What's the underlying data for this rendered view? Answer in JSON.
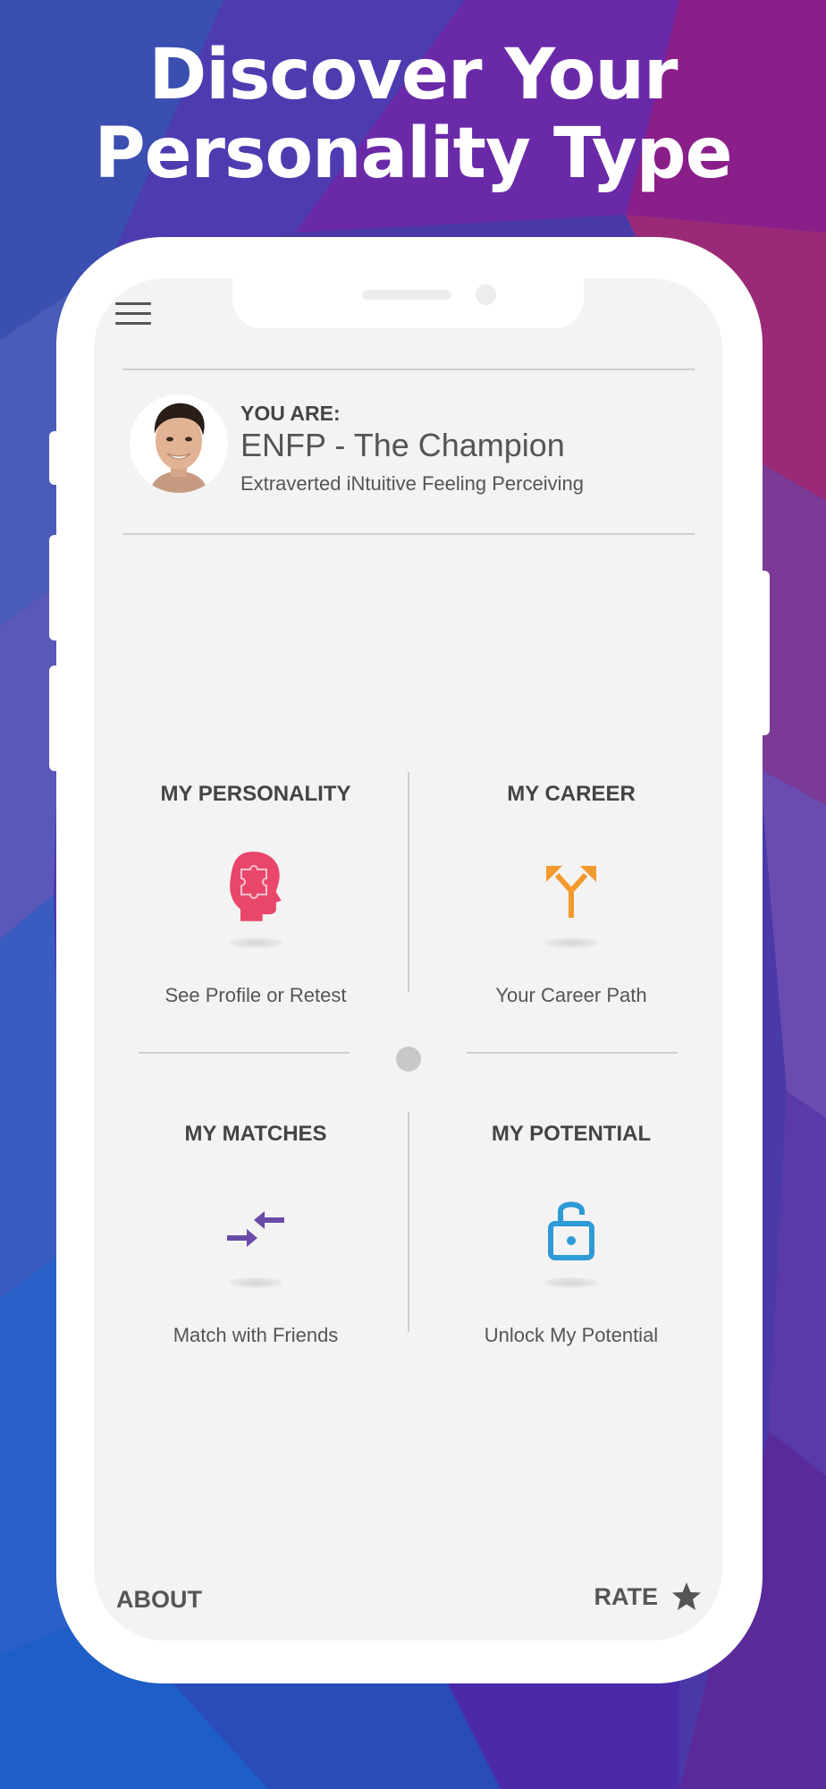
{
  "headline": {
    "line1": "Discover Your",
    "line2": "Personality Type"
  },
  "profile": {
    "label": "YOU ARE:",
    "type": "ENFP - The Champion",
    "description": "Extraverted iNtuitive Feeling Perceiving"
  },
  "tiles": [
    {
      "title": "MY PERSONALITY",
      "subtitle": "See Profile or Retest",
      "icon": "head-puzzle-icon",
      "color": "#e8476a"
    },
    {
      "title": "MY CAREER",
      "subtitle": "Your Career Path",
      "icon": "fork-arrows-icon",
      "color": "#f29a2e"
    },
    {
      "title": "MY MATCHES",
      "subtitle": "Match with Friends",
      "icon": "converge-arrows-icon",
      "color": "#6a4ba8"
    },
    {
      "title": "MY POTENTIAL",
      "subtitle": "Unlock My Potential",
      "icon": "unlock-icon",
      "color": "#2e9ad6"
    }
  ],
  "footer": {
    "about": "ABOUT",
    "rate": "RATE"
  },
  "colors": {
    "accent_personality": "#e8476a",
    "accent_career": "#f29a2e",
    "accent_matches": "#6a4ba8",
    "accent_potential": "#2e9ad6"
  }
}
